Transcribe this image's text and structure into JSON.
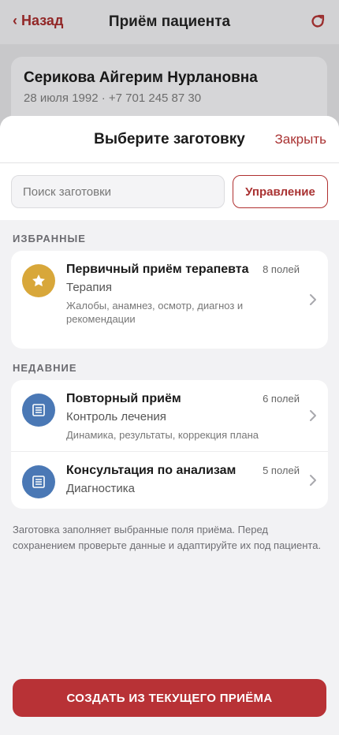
{
  "topbar": {
    "back_label": "‹ Назад",
    "title": "Приём пациента"
  },
  "patient": {
    "name": "Серикова Айгерим Нурлановна",
    "meta": "28 июля 1992 · +7 701 245 87 30"
  },
  "sheet": {
    "title": "Выберите заготовку",
    "close_label": "Закрыть",
    "search_placeholder": "Поиск заготовки",
    "manage_label": "Управление",
    "favorites_label": "ИЗБРАННЫЕ",
    "recent_label": "НЕДАВНИЕ",
    "favorites": [
      {
        "title": "Первичный приём терапевта",
        "category": "Терапия",
        "description": "Жалобы, анамнез, осмотр, диагноз и рекомендации",
        "count": "8 полей",
        "icon": "star-icon"
      }
    ],
    "recent": [
      {
        "title": "Повторный приём",
        "category": "Контроль лечения",
        "description": "Динамика, результаты, коррекция плана",
        "count": "6 полей",
        "icon": "document-icon"
      },
      {
        "title": "Консультация по анализам",
        "category": "Диагностика",
        "count": "5 полей",
        "icon": "document-icon"
      }
    ],
    "note": "Заготовка заполняет выбранные поля приёма. Перед сохранением проверьте данные и адаптируйте их под пациента.",
    "cta_label": "СОЗДАТЬ ИЗ ТЕКУЩЕГО ПРИЁМА"
  },
  "colors": {
    "accent": "#b83236",
    "star_badge": "#d8a73a",
    "doc_badge": "#4a78b5"
  }
}
